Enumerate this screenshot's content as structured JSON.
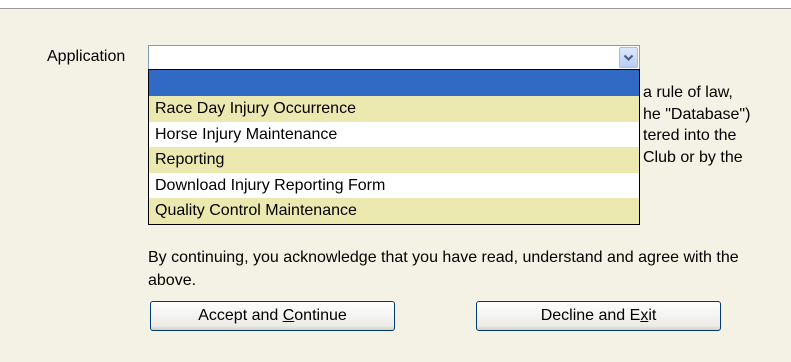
{
  "form": {
    "application_label": "Application",
    "application_value": ""
  },
  "dropdown": {
    "options": [
      {
        "label": "",
        "state": "highlighted"
      },
      {
        "label": "Race Day Injury Occurrence"
      },
      {
        "label": "Horse Injury Maintenance"
      },
      {
        "label": "Reporting"
      },
      {
        "label": "Download Injury Reporting Form"
      },
      {
        "label": "Quality Control Maintenance"
      }
    ]
  },
  "disclaimer_fragments": [
    "a rule of law,",
    "he \"Database\")",
    "tered into the",
    "Club or by the"
  ],
  "acknowledgement": "By continuing, you acknowledge that you have read, understand and agree with the above.",
  "buttons": {
    "accept": {
      "pre": "Accept and ",
      "mnemonic": "C",
      "post": "ontinue"
    },
    "decline": {
      "pre": "Decline and E",
      "mnemonic": "x",
      "post": "it"
    }
  },
  "colors": {
    "panel_bg": "#f4f2e4",
    "selected_option": "#316ac5",
    "alt_option": "#ece9b0",
    "button_border": "#003c74"
  },
  "icons": {
    "select_arrow": "chevron-down-icon"
  }
}
